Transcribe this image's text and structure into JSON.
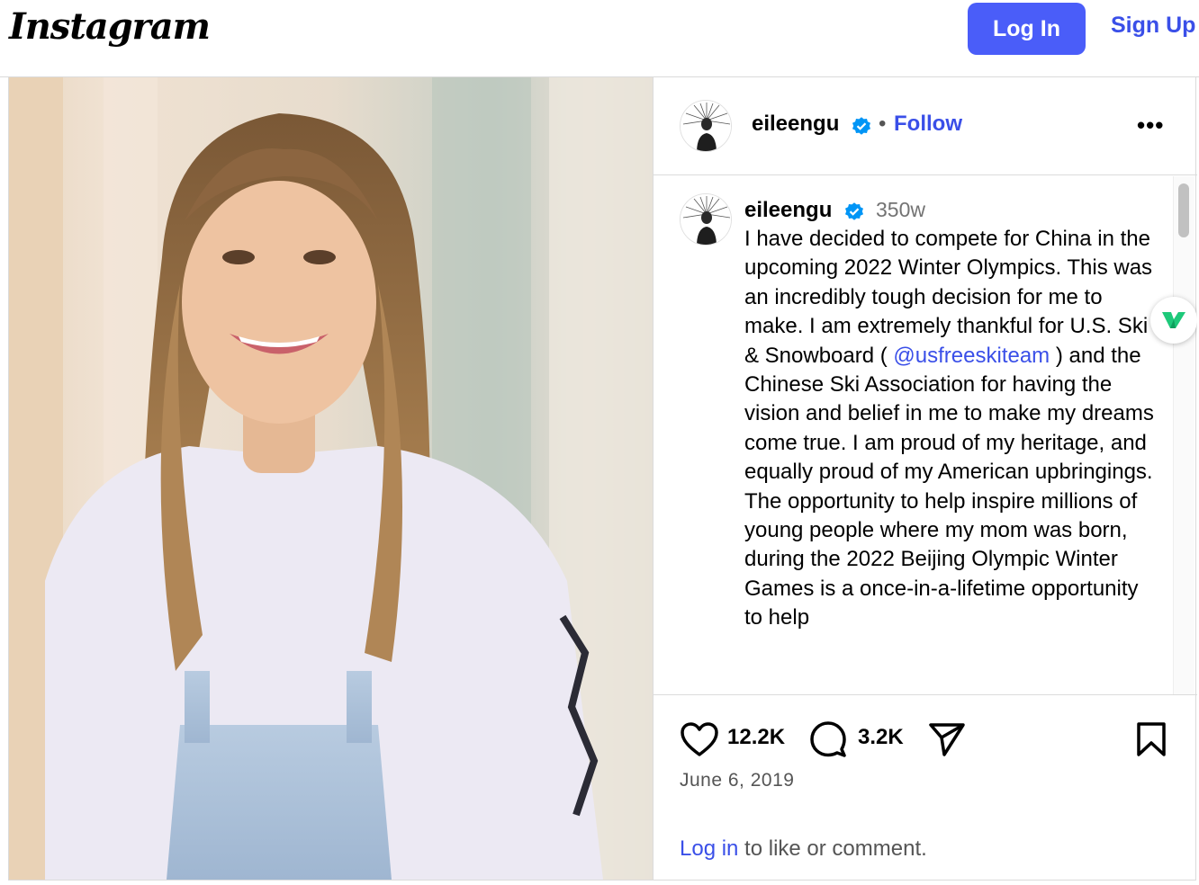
{
  "header": {
    "logo_text": "Instagram",
    "login_label": "Log In",
    "signup_label": "Sign Up"
  },
  "post": {
    "photo_alt": "Smiling young woman with long hair in a white long-sleeve shirt and denim overalls",
    "author": "eileengu",
    "separator": "•",
    "follow_label": "Follow",
    "more_label": "•••",
    "caption": {
      "author": "eileengu",
      "time": "350w",
      "text_before": "I have decided to compete for China in the upcoming 2022 Winter Olympics. This was an incredibly tough decision for me to make. I am extremely thankful for U.S. Ski & Snowboard ( ",
      "mention": "@usfreeskiteam",
      "text_after": " ) and the Chinese Ski Association for having the vision and belief in me to make my dreams come true. I am proud of my heritage, and equally proud of my American upbringings. The opportunity to help inspire millions of young people where my mom was born, during the 2022 Beijing Olympic Winter Games is a once-in-a-lifetime opportunity to help"
    },
    "likes": "12.2K",
    "comments": "3.2K",
    "date": "June 6, 2019",
    "login_prompt_link": "Log in",
    "login_prompt_text": " to like or comment."
  },
  "colors": {
    "accent": "#4a5df9",
    "link": "#3a4fe8",
    "verified": "#0095f6",
    "muted": "#737373",
    "border": "#dbdbdb"
  },
  "icons": [
    "verified-badge-icon",
    "more-options-icon",
    "heart-icon",
    "comment-icon",
    "share-icon",
    "bookmark-icon",
    "extension-icon"
  ]
}
